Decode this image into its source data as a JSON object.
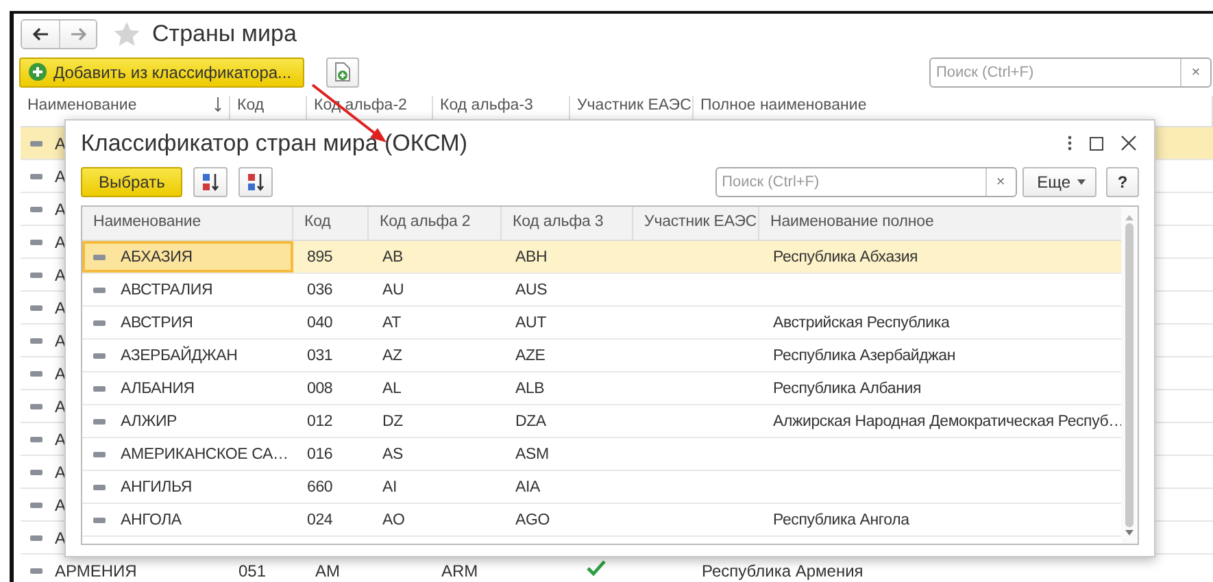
{
  "window": {
    "title": "Страны мира"
  },
  "toolbar": {
    "add_button": "Добавить из классификатора...",
    "search": {
      "placeholder": "Поиск (Ctrl+F)"
    },
    "clear": "×"
  },
  "table": {
    "columns": [
      "Наименование",
      "Код",
      "Код альфа-2",
      "Код альфа-3",
      "Участник ЕАЭС",
      "Полное наименование"
    ],
    "rows": [
      {
        "name": "А",
        "selected": true
      },
      {
        "name": "А",
        "selected": false
      },
      {
        "name": "А",
        "selected": false
      },
      {
        "name": "А",
        "selected": false
      },
      {
        "name": "А",
        "selected": false
      },
      {
        "name": "А",
        "selected": false
      },
      {
        "name": "А",
        "selected": false
      },
      {
        "name": "А",
        "selected": false
      },
      {
        "name": "А",
        "selected": false
      },
      {
        "name": "А",
        "selected": false
      },
      {
        "name": "А",
        "selected": false
      },
      {
        "name": "А",
        "selected": false
      },
      {
        "name": "А",
        "selected": false
      },
      {
        "name": "АРМЕНИЯ",
        "code": "051",
        "alpha2": "AM",
        "alpha3": "ARM",
        "eaeu_member": true,
        "full_name": "Республика Армения",
        "selected": false
      }
    ]
  },
  "dialog": {
    "title": "Классификатор стран мира (ОКСМ)",
    "select_button": "Выбрать",
    "search": {
      "placeholder": "Поиск (Ctrl+F)"
    },
    "clear": "×",
    "more_button": "Еще",
    "help_button": "?",
    "table": {
      "columns": [
        "Наименование",
        "Код",
        "Код альфа 2",
        "Код альфа 3",
        "Участник ЕАЭС",
        "Наименование полное"
      ],
      "rows": [
        {
          "name": "АБХАЗИЯ",
          "code": "895",
          "alpha2": "AB",
          "alpha3": "ABH",
          "full_name": "Республика Абхазия",
          "selected": true
        },
        {
          "name": "АВСТРАЛИЯ",
          "code": "036",
          "alpha2": "AU",
          "alpha3": "AUS",
          "selected": false
        },
        {
          "name": "АВСТРИЯ",
          "code": "040",
          "alpha2": "AT",
          "alpha3": "AUT",
          "full_name": "Австрийская Республика",
          "selected": false
        },
        {
          "name": "АЗЕРБАЙДЖАН",
          "code": "031",
          "alpha2": "AZ",
          "alpha3": "AZE",
          "full_name": "Республика Азербайджан",
          "selected": false
        },
        {
          "name": "АЛБАНИЯ",
          "code": "008",
          "alpha2": "AL",
          "alpha3": "ALB",
          "full_name": "Республика Албания",
          "selected": false
        },
        {
          "name": "АЛЖИР",
          "code": "012",
          "alpha2": "DZ",
          "alpha3": "DZA",
          "full_name": "Алжирская Народная Демократическая Респуб…",
          "selected": false
        },
        {
          "name": "АМЕРИКАНСКОЕ СА…",
          "code": "016",
          "alpha2": "AS",
          "alpha3": "ASM",
          "selected": false
        },
        {
          "name": "АНГИЛЬЯ",
          "code": "660",
          "alpha2": "AI",
          "alpha3": "AIA",
          "selected": false
        },
        {
          "name": "АНГОЛА",
          "code": "024",
          "alpha2": "AO",
          "alpha3": "AGO",
          "full_name": "Республика Ангола",
          "selected": false
        }
      ]
    }
  }
}
